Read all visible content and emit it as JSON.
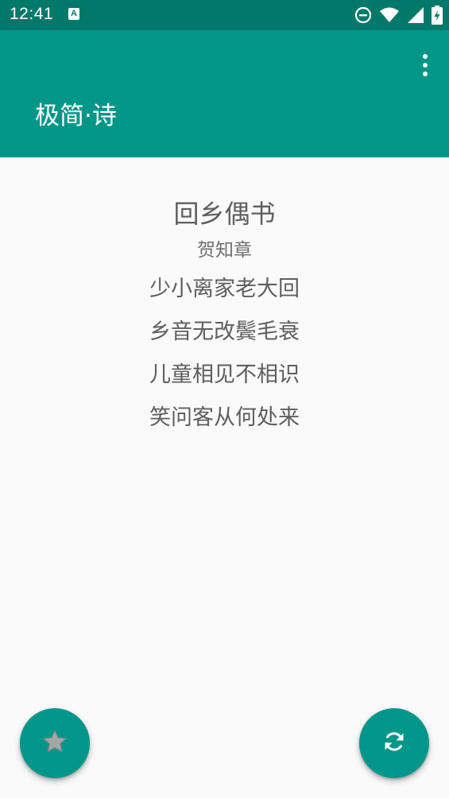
{
  "status_bar": {
    "time": "12:41",
    "notification_icon": "A",
    "icons": [
      "do-not-disturb-icon",
      "wifi-icon",
      "signal-icon",
      "battery-charging-icon"
    ]
  },
  "app_bar": {
    "title": "极简·诗",
    "menu_icon": "more-vert-icon",
    "color": "#009688"
  },
  "poem": {
    "title": "回乡偶书",
    "author": "贺知章",
    "lines": [
      "少小离家老大回",
      "乡音无改鬓毛衰",
      "儿童相见不相识",
      "笑问客从何处来"
    ]
  },
  "fabs": {
    "favorite_icon": "star-icon",
    "refresh_icon": "refresh-icon",
    "color": "#00968a"
  }
}
